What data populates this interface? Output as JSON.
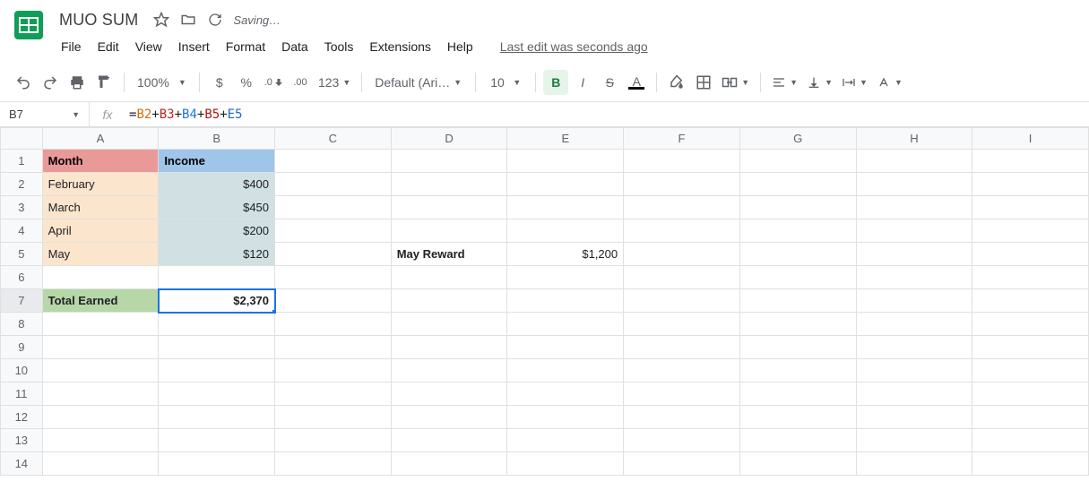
{
  "doc": {
    "title": "MUO SUM",
    "saving": "Saving…"
  },
  "menus": [
    "File",
    "Edit",
    "View",
    "Insert",
    "Format",
    "Data",
    "Tools",
    "Extensions",
    "Help"
  ],
  "last_edit": "Last edit was seconds ago",
  "toolbar": {
    "zoom": "100%",
    "currency": "$",
    "percent": "%",
    "dec_dec": ".0",
    "inc_dec": ".00",
    "more_fmt": "123",
    "font": "Default (Ari…",
    "font_size": "10",
    "bold": "B",
    "italic": "I",
    "strike": "S",
    "text_color_letter": "A"
  },
  "name_box": "B7",
  "fx": "fx",
  "formula": {
    "eq": "=",
    "b2": "B2",
    "p1": "+",
    "b3": "B3",
    "p2": "+",
    "b4": "B4",
    "p3": "+",
    "b5": "B5",
    "p4": "+",
    "e5": "E5"
  },
  "columns": [
    "A",
    "B",
    "C",
    "D",
    "E",
    "F",
    "G",
    "H",
    "I"
  ],
  "rows": [
    "1",
    "2",
    "3",
    "4",
    "5",
    "6",
    "7",
    "8",
    "9",
    "10",
    "11",
    "12",
    "13",
    "14"
  ],
  "cells": {
    "A1": "Month",
    "B1": "Income",
    "A2": "February",
    "B2": "$400",
    "A3": "March",
    "B3": "$450",
    "A4": "April",
    "B4": "$200",
    "A5": "May",
    "B5": "$120",
    "D5": "May Reward",
    "E5": "$1,200",
    "A7": "Total Earned",
    "B7": "$2,370"
  },
  "chart_data": {
    "type": "table",
    "title": "MUO SUM",
    "columns": [
      "Month",
      "Income"
    ],
    "rows": [
      {
        "Month": "February",
        "Income": 400
      },
      {
        "Month": "March",
        "Income": 450
      },
      {
        "Month": "April",
        "Income": 200
      },
      {
        "Month": "May",
        "Income": 120
      }
    ],
    "extras": {
      "May Reward": 1200
    },
    "total_earned": 2370,
    "formula": "=B2+B3+B4+B5+E5"
  }
}
